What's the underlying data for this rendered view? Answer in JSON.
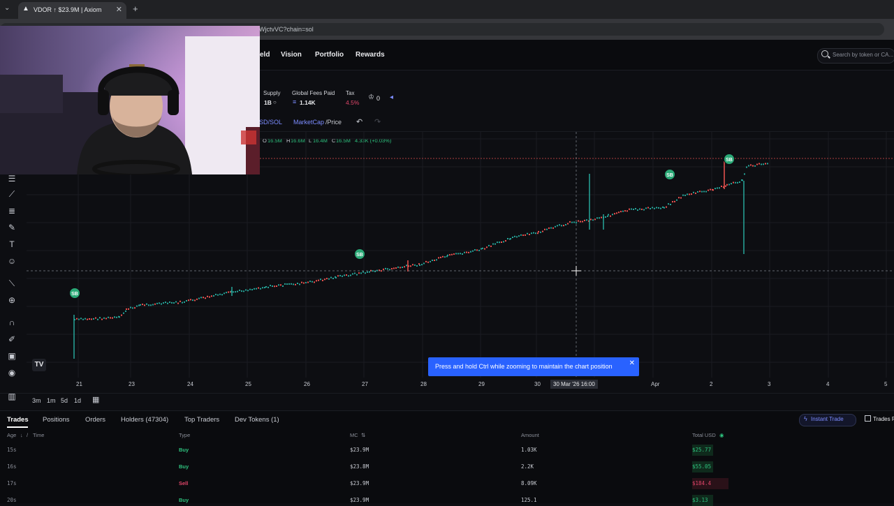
{
  "browser": {
    "tab_title": "VDOR ↑ $23.9M | Axiom",
    "url_suffix": "WjctvVC?chain=sol"
  },
  "nav": {
    "items": [
      {
        "label": "eld"
      },
      {
        "label": "Vision"
      },
      {
        "label": "Portfolio"
      },
      {
        "label": "Rewards"
      }
    ],
    "search_placeholder": "Search by token or CA..."
  },
  "stats": {
    "supply_label": "Supply",
    "supply_value": "1B",
    "fees_label": "Global Fees Paid",
    "fees_value": "1.14K",
    "tax_label": "Tax",
    "tax_value": "4.5%",
    "holders_count": "0"
  },
  "chart_header": {
    "pair": "SD/SOL",
    "mode_active": "MarketCap",
    "mode_other": "/Price",
    "ohlc": {
      "o_label": "O",
      "o": "16.5M",
      "h_label": "H",
      "h": "16.6M",
      "l_label": "L",
      "l": "16.4M",
      "c_label": "C",
      "c": "16.5M",
      "change": "4.33K (+0.03%)"
    }
  },
  "chart_data": {
    "type": "candlestick",
    "x_ticks": [
      "21",
      "23",
      "24",
      "25",
      "26",
      "27",
      "28",
      "29",
      "30",
      "30 Mar '26  16:00",
      "Apr",
      "2",
      "3",
      "4",
      "5"
    ],
    "crosshair_label": "30 Mar '26  16:00",
    "markers": [
      "SB",
      "SB",
      "SB",
      "SB"
    ],
    "colors": {
      "up": "#26a69a",
      "down": "#ef5350",
      "marker": "#2aa876"
    }
  },
  "timeframes": [
    "3m",
    "1m",
    "5d",
    "1d"
  ],
  "toast": {
    "message": "Press and hold Ctrl while zooming to maintain the chart position"
  },
  "tv_logo": "TV",
  "panel": {
    "tabs": [
      "Trades",
      "Positions",
      "Orders",
      "Holders (47304)",
      "Top Traders",
      "Dev Tokens (1)"
    ],
    "instant_trade": "Instant Trade",
    "trades_panel": "Trades P",
    "columns": {
      "age": "Age",
      "time": "Time",
      "type": "Type",
      "mc": "MC",
      "amount": "Amount",
      "total": "Total USD"
    },
    "rows": [
      {
        "age": "15s",
        "type": "Buy",
        "mc": "$23.9M",
        "amount": "1.03K",
        "total": "$25.77"
      },
      {
        "age": "16s",
        "type": "Buy",
        "mc": "$23.8M",
        "amount": "2.2K",
        "total": "$55.05"
      },
      {
        "age": "17s",
        "type": "Sell",
        "mc": "$23.9M",
        "amount": "8.09K",
        "total": "$184.4"
      },
      {
        "age": "20s",
        "type": "Buy",
        "mc": "$23.9M",
        "amount": "125.1",
        "total": "$3.13"
      }
    ]
  }
}
